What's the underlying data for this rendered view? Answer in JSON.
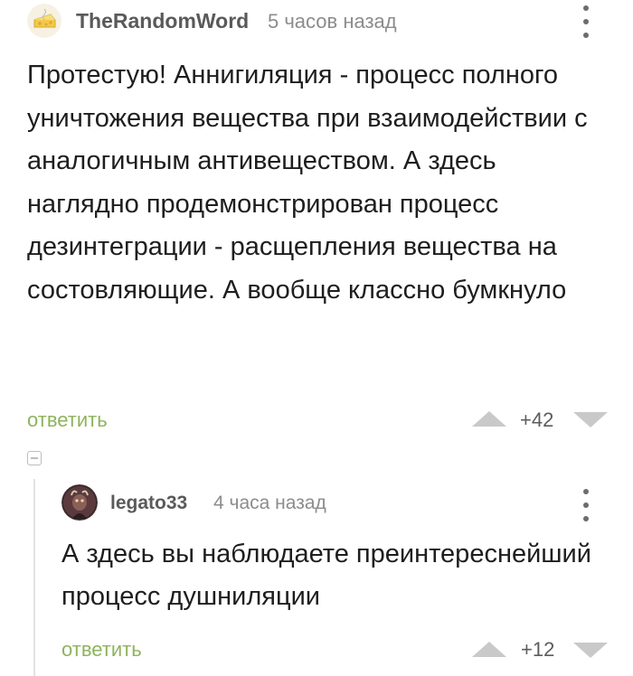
{
  "comments": [
    {
      "author": "TheRandomWord",
      "time": "5 часов назад",
      "text": "Протестую! Аннигиляция - процесс полного уничтожения вещества при взаимодействии с аналогичным антивеществом. А здесь наглядно продемонстрирован процесс дезинтеграции - расщепления вещества на состовляющие. А вообще классно бумкнуло",
      "reply_label": "ответить",
      "rating": "+42"
    },
    {
      "author": "legato33",
      "time": "4 часа назад",
      "text": "А здесь вы наблюдаете преинтереснейший процесс душниляции",
      "reply_label": "ответить",
      "rating": "+12"
    }
  ],
  "colors": {
    "reply_link": "#8fb35e",
    "vote_arrow": "#c9c9c9",
    "username": "#5a5a5a",
    "timestamp": "#8c8c8c"
  },
  "icons": {
    "collapse": "collapse-thread-icon",
    "menu": "kebab-menu-icon",
    "upvote": "upvote-icon",
    "downvote": "downvote-icon"
  }
}
